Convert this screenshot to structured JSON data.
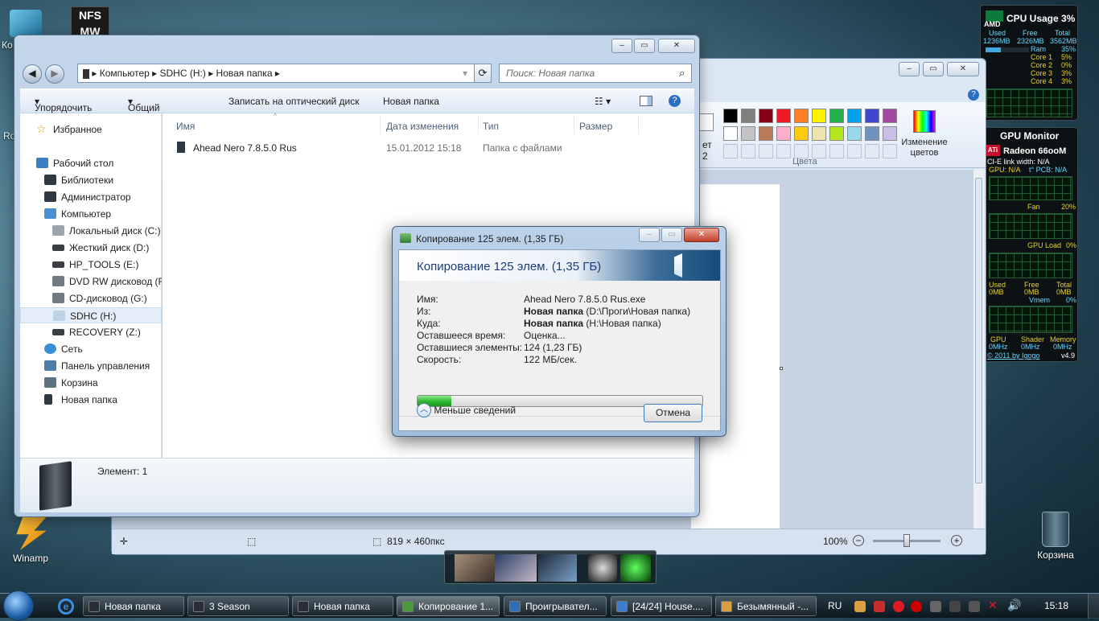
{
  "desktop": {
    "icons": [
      {
        "label": "Ко"
      },
      {
        "label": "Ro"
      },
      {
        "label": "Winamp"
      },
      {
        "label": "Корзина"
      }
    ]
  },
  "cpu_gadget": {
    "title": "CPU Usage",
    "percent": "3%",
    "brand": "AMD",
    "h_used": "Used",
    "h_free": "Free",
    "h_total": "Total",
    "used": "1236MB",
    "free": "2326MB",
    "total": "3562MB",
    "ram_label": "Ram",
    "ram_pct": "35%",
    "ram_fill": 0.35,
    "cores": [
      {
        "name": "Core 1",
        "pct": "5%"
      },
      {
        "name": "Core 2",
        "pct": "0%"
      },
      {
        "name": "Core 3",
        "pct": "3%"
      },
      {
        "name": "Core 4",
        "pct": "3%"
      }
    ]
  },
  "gpu_gadget": {
    "title": "GPU Monitor",
    "card": "Radeon 66ooM",
    "brand": "ATi",
    "link": "CI-E link width: N/A",
    "gpu_temp": "GPU: N/A",
    "pcb_temp": "t° PCB: N/A",
    "fan_label": "Fan",
    "fan_pct": "20%",
    "load_label": "GPU Load",
    "load_pct": "0%",
    "mem_used_h": "Used",
    "mem_free_h": "Free",
    "mem_total_h": "Total",
    "mem_used": "0MB",
    "mem_free": "0MB",
    "mem_total": "0MB",
    "vmem_label": "Vmem",
    "vmem_pct": "0%",
    "clk_gpu_h": "GPU",
    "clk_shader_h": "Shader",
    "clk_mem_h": "Memory",
    "clk_gpu": "0MHz",
    "clk_shader": "0MHz",
    "clk_mem": "0MHz",
    "credit": "© 2011 by Igogo",
    "version": "v4.9"
  },
  "paint": {
    "colors_group_label": "Цвета",
    "edit_colors_label": "Изменение цветов",
    "color2_label_a": "ет",
    "color2_label_b": "2",
    "palette_row1": [
      "#000000",
      "#7f7f7f",
      "#880015",
      "#ed1c24",
      "#ff7f27",
      "#fff200",
      "#22b14c",
      "#00a2e8",
      "#3f48cc",
      "#a349a4"
    ],
    "palette_row2": [
      "#ffffff",
      "#c3c3c3",
      "#b97a57",
      "#ffaec9",
      "#ffc90e",
      "#efe4b0",
      "#b5e61d",
      "#99d9ea",
      "#7092be",
      "#c8bfe7"
    ],
    "status_size": "819 × 460пкс",
    "zoom": "100%"
  },
  "explorer": {
    "breadcrumb": [
      "Компьютер",
      "SDHC (H:)",
      "Новая папка"
    ],
    "search_placeholder": "Поиск: Новая папка",
    "toolbar": {
      "organize": "Упорядочить",
      "share": "Общий доступ",
      "burn": "Записать на оптический диск",
      "new_folder": "Новая папка"
    },
    "nav": {
      "favorites": "Избранное",
      "desktop": "Рабочий стол",
      "libraries": "Библиотеки",
      "admin": "Администратор",
      "computer": "Компьютер",
      "drive_c": "Локальный диск (C:)",
      "drive_d": "Жесткий диск (D:)",
      "drive_e": "HP_TOOLS (E:)",
      "drive_f": "DVD RW дисковод (F:",
      "drive_g": "CD-дисковод (G:)",
      "drive_h": "SDHC (H:)",
      "drive_z": "RECOVERY (Z:)",
      "network": "Сеть",
      "control_panel": "Панель управления",
      "recycle": "Корзина",
      "new_folder": "Новая папка"
    },
    "columns": {
      "name": "Имя",
      "date": "Дата изменения",
      "type": "Тип",
      "size": "Размер"
    },
    "files": [
      {
        "name": "Ahead Nero 7.8.5.0 Rus",
        "date": "15.01.2012 15:18",
        "type": "Папка с файлами",
        "size": ""
      }
    ],
    "details": "Элемент: 1"
  },
  "copy_dialog": {
    "window_title": "Копирование 125 элем. (1,35 ГБ)",
    "heading": "Копирование 125 элем. (1,35 ГБ)",
    "labels": {
      "name": "Имя:",
      "from": "Из:",
      "to": "Куда:",
      "time_left": "Оставшееся время:",
      "items_left": "Оставшиеся элементы:",
      "speed": "Скорость:"
    },
    "values": {
      "name": "Ahead Nero 7.8.5.0 Rus.exe",
      "from_bold": "Новая папка",
      "from_path": "(D:\\Проги\\Новая папка)",
      "to_bold": "Новая папка",
      "to_path": "(H:\\Новая папка)",
      "time_left": "Оценка...",
      "items_left": "124 (1,23 ГБ)",
      "speed": "122 МБ/сек."
    },
    "progress": 0.12,
    "less_details": "Меньше сведений",
    "cancel": "Отмена"
  },
  "taskbar": {
    "tasks": [
      {
        "label": "Новая папка",
        "color": "#2a2f36"
      },
      {
        "label": "3 Season",
        "color": "#2a2f36"
      },
      {
        "label": "Новая папка",
        "color": "#2a2f36"
      },
      {
        "label": "Копирование 1...",
        "color": "#4a9a3a"
      },
      {
        "label": "Проигрывател...",
        "color": "#2f6fb5"
      },
      {
        "label": "[24/24] House....",
        "color": "#3b7bd0"
      },
      {
        "label": "Безымянный -...",
        "color": "#d8a040"
      }
    ],
    "lang": "RU",
    "clock": "15:18"
  }
}
